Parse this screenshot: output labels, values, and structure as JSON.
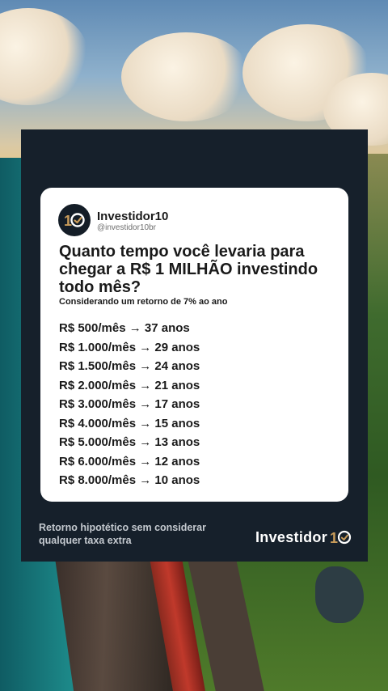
{
  "post": {
    "author": {
      "name": "Investidor10",
      "handle": "@investidor10br",
      "avatar_icon": "investidor10-logo-icon"
    },
    "question": "Quanto tempo você levaria para chegar a R$ 1 MILHÃO investindo todo mês?",
    "subtitle": "Considerando um retorno de 7% ao ano",
    "rows": [
      "R$ 500/mês → 37 anos",
      "R$ 1.000/mês → 29 anos",
      "R$ 1.500/mês → 24 anos",
      "R$ 2.000/mês → 21 anos",
      "R$ 3.000/mês → 17 anos",
      "R$ 4.000/mês → 15 anos",
      "R$ 5.000/mês → 13 anos",
      "R$ 6.000/mês → 12 anos",
      "R$ 8.000/mês → 10 anos"
    ]
  },
  "footer": {
    "note": "Retorno hipotético sem considerar qualquer taxa extra",
    "brand": "Investidor",
    "brand_mark_icon": "ten-check-icon"
  },
  "colors": {
    "panel": "#16202b",
    "card": "#ffffff",
    "text": "#1a1a1a",
    "brand_accent": "#c89b5a"
  }
}
